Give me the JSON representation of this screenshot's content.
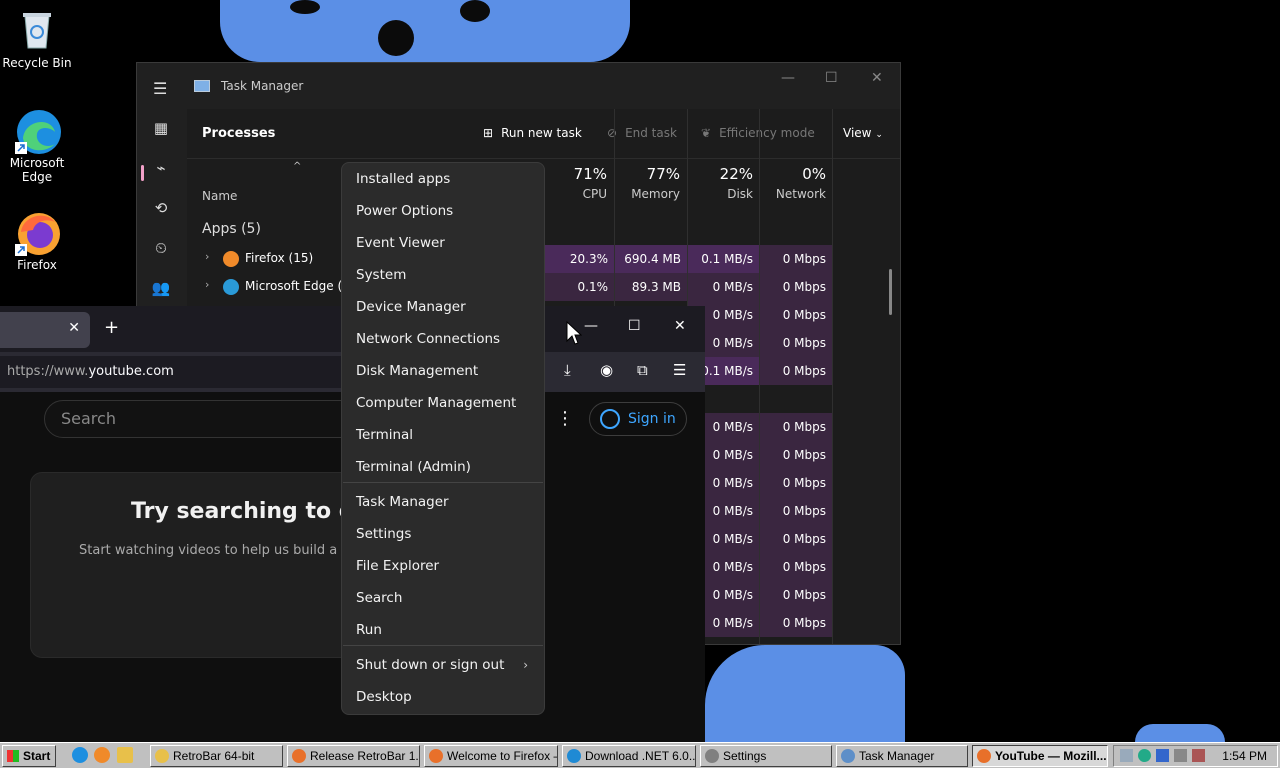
{
  "desktop": {
    "icons": [
      {
        "label": "Recycle Bin"
      },
      {
        "label": "Microsoft Edge"
      },
      {
        "label": "Firefox"
      }
    ]
  },
  "task_manager": {
    "title": "Task Manager",
    "heading": "Processes",
    "run_new_task": "Run new task",
    "end_task": "End task",
    "efficiency_mode": "Efficiency mode",
    "view": "View",
    "name_col": "Name",
    "columns": [
      {
        "pct": "71%",
        "label": "CPU"
      },
      {
        "pct": "77%",
        "label": "Memory"
      },
      {
        "pct": "22%",
        "label": "Disk"
      },
      {
        "pct": "0%",
        "label": "Network"
      }
    ],
    "group": "Apps (5)",
    "apps": [
      {
        "name": "Firefox (15)",
        "cpu": "20.3%",
        "memory": "690.4 MB",
        "disk": "0.1 MB/s",
        "network": "0 Mbps"
      },
      {
        "name": "Microsoft Edge (8)",
        "cpu": "0.1%",
        "memory": "89.3 MB",
        "disk": "0 MB/s",
        "network": "0 Mbps"
      }
    ],
    "rows_visible": [
      {
        "disk": "0 MB/s",
        "network": "0 Mbps"
      },
      {
        "disk": "0 MB/s",
        "network": "0 Mbps"
      },
      {
        "disk": "0.1 MB/s",
        "network": "0 Mbps"
      },
      {
        "disk": "",
        "network": ""
      },
      {
        "disk": "0 MB/s",
        "network": "0 Mbps"
      },
      {
        "disk": "0 MB/s",
        "network": "0 Mbps"
      },
      {
        "disk": "0 MB/s",
        "network": "0 Mbps"
      },
      {
        "disk": "0 MB/s",
        "network": "0 Mbps"
      },
      {
        "disk": "0 MB/s",
        "network": "0 Mbps"
      },
      {
        "disk": "0 MB/s",
        "network": "0 Mbps"
      },
      {
        "disk": "0 MB/s",
        "network": "0 Mbps"
      },
      {
        "disk": "0 MB/s",
        "network": "0 Mbps"
      }
    ]
  },
  "firefox": {
    "url_prefix": "https://www.",
    "url_host": "youtube.com",
    "search_placeholder": "Search",
    "sign_in": "Sign in",
    "card_heading": "Try searching to get",
    "card_sub": "Start watching videos to help us build a fee"
  },
  "context_menu": {
    "group1": [
      "Installed apps",
      "Power Options",
      "Event Viewer",
      "System",
      "Device Manager",
      "Network Connections",
      "Disk Management",
      "Computer Management",
      "Terminal",
      "Terminal (Admin)"
    ],
    "group2": [
      "Task Manager",
      "Settings",
      "File Explorer",
      "Search",
      "Run"
    ],
    "group3": [
      "Shut down or sign out",
      "Desktop"
    ]
  },
  "taskbar": {
    "start": "Start",
    "buttons": [
      {
        "label": "RetroBar 64-bit",
        "icon_color": "#e8c04a"
      },
      {
        "label": "Release RetroBar 1....",
        "icon_color": "#e8702a"
      },
      {
        "label": "Welcome to Firefox –...",
        "icon_color": "#e8702a"
      },
      {
        "label": "Download .NET 6.0...",
        "icon_color": "#1f8ad4"
      },
      {
        "label": "Settings",
        "icon_color": "#808080"
      },
      {
        "label": "Task Manager",
        "icon_color": "#5e8fc8"
      },
      {
        "label": "YouTube — Mozill...",
        "icon_color": "#e8702a"
      }
    ],
    "clock": "1:54 PM"
  }
}
